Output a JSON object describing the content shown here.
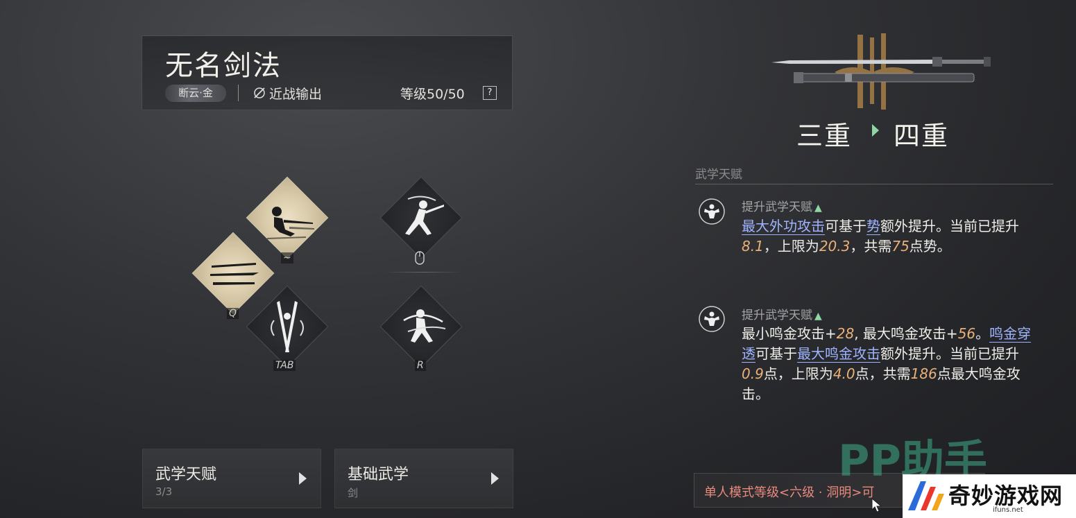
{
  "skill": {
    "name": "无名剑法",
    "tag": "断云·金",
    "role": "近战输出",
    "level": "等级50/50",
    "help": "?"
  },
  "skills_grid": {
    "keys": {
      "top_left": "~",
      "left": "Q",
      "bottom_left": "TAB",
      "bottom_right": "R"
    },
    "icons": {
      "top_left": "leaping-swordsman-icon",
      "left": "triple-slash-icon",
      "bottom_left": "crossed-blades-icon",
      "top_right": "lunging-swordsman-icon",
      "bottom_right": "spinning-swordsman-icon",
      "top_right_key": "mouse-icon"
    }
  },
  "bottom_buttons": [
    {
      "label": "武学天赋",
      "sub": "3/3"
    },
    {
      "label": "基础武学",
      "sub": "剑"
    }
  ],
  "progression": {
    "from": "三重",
    "to": "四重"
  },
  "talents": {
    "section_title": "武学天赋",
    "items": [
      {
        "heading": "提升武学天赋",
        "p1_link": "最大外功攻击",
        "p1_a": "可基于",
        "p1_link2": "势",
        "p1_b": "额外提升。当前已提升",
        "v1": "8.1",
        "p1_c": "，上限为",
        "v2": "20.3",
        "p1_d": "，共需",
        "v3": "75",
        "p1_e": "点势。"
      },
      {
        "heading": "提升武学天赋",
        "p2_a": "最小鸣金攻击+",
        "v1": "28",
        "p2_b": ", 最大鸣金攻击+",
        "v2": "56",
        "p2_c": "。",
        "p2_link": "鸣金穿透",
        "p2_d": "可基于",
        "p2_link2": "最大鸣金攻击",
        "p2_e": "额外提升。当前已提升",
        "v3": "0.9",
        "p2_f": "点，上限为",
        "v4": "4.0",
        "p2_g": "点，共需",
        "v5": "186",
        "p2_h": "点最大鸣金攻击。"
      }
    ]
  },
  "mode_notice": "单人模式等级<六级 · 洞明>可",
  "watermarks": {
    "pp_text": "PP助手",
    "logo_text": "奇妙游戏网",
    "logo_url": "ifuns.net"
  },
  "colors": {
    "accent_green": "#8fd6a4",
    "link_blue": "#9fb4ff",
    "number_orange": "#e9b07a",
    "warning_red": "#e98a7e",
    "diamond_light": "#d7c9a8"
  }
}
